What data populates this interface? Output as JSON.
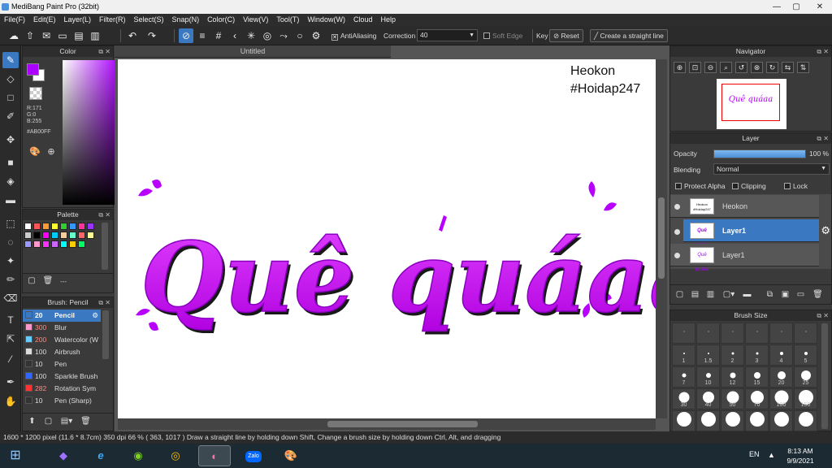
{
  "window": {
    "title": "MediBang Paint Pro (32bit)",
    "minimize": "—",
    "maximize": "▢",
    "close": "✕"
  },
  "menu": [
    "File(F)",
    "Edit(E)",
    "Layer(L)",
    "Filter(R)",
    "Select(S)",
    "Snap(N)",
    "Color(C)",
    "View(V)",
    "Tool(T)",
    "Window(W)",
    "Cloud",
    "Help"
  ],
  "toolbar": {
    "antialiasing_label": "AntiAliasing",
    "correction_label": "Correction",
    "correction_value": "40",
    "soft_edge_label": "Soft Edge",
    "key_label": "Key",
    "reset_label": "Reset",
    "straight_line_label": "Create a straight line"
  },
  "color_panel": {
    "title": "Color",
    "r": "R:171",
    "g": "G:0",
    "b": "B:255",
    "hex": "#AB00FF",
    "fg_color": "#ab00ff",
    "bg_color": "#ffffff"
  },
  "palette_panel": {
    "title": "Palette",
    "colors": [
      "#ffffff",
      "#ff5555",
      "#ff9933",
      "#ffff33",
      "#33cc33",
      "#3399ff",
      "#ff3399",
      "#9933ff",
      "#cccccc",
      "#000000",
      "#ff00ff",
      "#00ccff",
      "#ffcc99",
      "#66ffcc",
      "#ff6666",
      "#ffff99",
      "#9999ff",
      "#ff99cc",
      "#ff33ff",
      "#cc66ff",
      "#00ffff",
      "#ffcc00",
      "#00ff66"
    ],
    "footer": "---"
  },
  "brush_panel": {
    "title": "Brush: Pencil",
    "items": [
      {
        "size": "20",
        "name": "Pencil",
        "color": "#3a78c2"
      },
      {
        "size": "300",
        "name": "Blur",
        "color": "#ff99cc"
      },
      {
        "size": "200",
        "name": "Watercolor (W",
        "color": "#66ccff"
      },
      {
        "size": "100",
        "name": "Airbrush",
        "color": "#dddddd"
      },
      {
        "size": "10",
        "name": "Pen",
        "color": "#333333"
      },
      {
        "size": "100",
        "name": "Sparkle Brush",
        "color": "#3366ff"
      },
      {
        "size": "282",
        "name": "Rotation Sym",
        "color": "#ff3333"
      },
      {
        "size": "10",
        "name": "Pen (Sharp)",
        "color": "#333333"
      }
    ]
  },
  "canvas": {
    "tab_title": "Untitled",
    "author": "Heokon",
    "hashtag": "#Hoidap247",
    "artwork_text": "Quê quáaa"
  },
  "navigator": {
    "title": "Navigator"
  },
  "layer_panel": {
    "title": "Layer",
    "opacity_label": "Opacity",
    "opacity_value": "100 %",
    "opacity_fraction": 1.0,
    "blending_label": "Blending",
    "blending_value": "Normal",
    "protect_alpha_label": "Protect Alpha",
    "clipping_label": "Clipping",
    "lock_label": "Lock",
    "layers": [
      {
        "name": "Heokon",
        "thumb": "Heokon #Hoidap247"
      },
      {
        "name": "Layer1",
        "thumb": "Quê quáaa"
      },
      {
        "name": "Layer1",
        "thumb": "Quê quáaa"
      }
    ]
  },
  "brush_size_panel": {
    "title": "Brush Size",
    "sizes": [
      "",
      "",
      "",
      "",
      "",
      "",
      "1",
      "1.5",
      "2",
      "3",
      "4",
      "5",
      "7",
      "10",
      "12",
      "15",
      "20",
      "25",
      "30",
      "40",
      "50",
      "70",
      "100",
      "150",
      "",
      "",
      "",
      "",
      "",
      ""
    ]
  },
  "status": {
    "image_size": "1600 * 1200 pixel",
    "physical_size": "(11.6 * 8.7cm)",
    "dpi": "350 dpi",
    "zoom": "66 %",
    "coords": "( 363, 1017 )",
    "hint": "Draw a straight line by holding down Shift, Change a brush size by holding down Ctrl, Alt, and dragging"
  },
  "taskbar": {
    "language": "EN",
    "time": "8:13 AM",
    "date": "9/9/2021",
    "zalo_label": "Zalo"
  }
}
